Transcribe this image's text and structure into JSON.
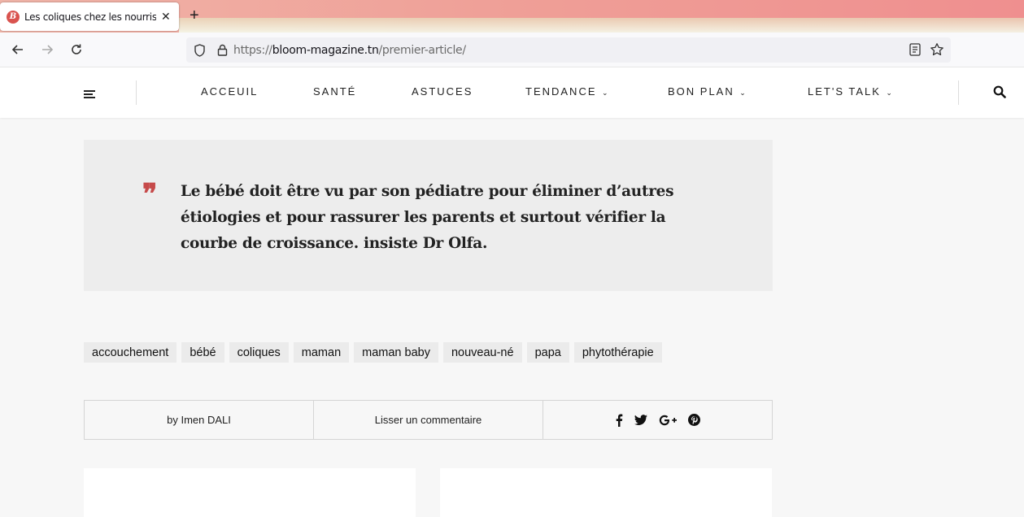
{
  "browser": {
    "tab_title": "Les coliques chez les nourrisso",
    "favicon_letter": "B",
    "url_prefix": "https://",
    "url_host": "bloom-magazine.tn",
    "url_path": "/premier-article/"
  },
  "nav": {
    "items": [
      {
        "label": "ACCEUIL"
      },
      {
        "label": "SANTÉ"
      },
      {
        "label": "ASTUCES"
      },
      {
        "label": "TENDANCE"
      },
      {
        "label": "BON PLAN"
      },
      {
        "label": "LET'S TALK"
      }
    ]
  },
  "quote": {
    "text": " Le bébé doit être vu par son pédiatre pour éliminer d’autres étiologies et pour rassurer les parents et surtout vérifier la courbe de croissance.  insiste Dr Olfa."
  },
  "tags": [
    "accouchement",
    "bébé",
    "coliques",
    "maman",
    "maman baby",
    "nouveau-né",
    "papa",
    "phytothérapie"
  ],
  "meta": {
    "author": "by Imen DALI",
    "comment": "Lisser un commentaire",
    "social": [
      "facebook-icon",
      "twitter-icon",
      "google-plus-icon",
      "pinterest-icon"
    ]
  },
  "colors": {
    "accent": "#c64a4a",
    "quote_bg": "#ededed",
    "page_bg": "#f7f7f7"
  }
}
